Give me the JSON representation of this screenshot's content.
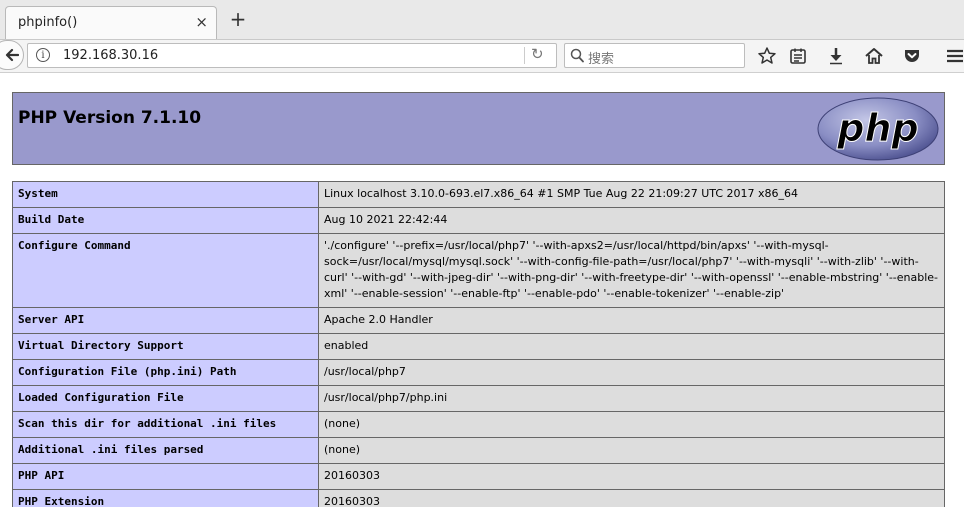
{
  "browser": {
    "tab_title": "phpinfo()",
    "tab_close": "×",
    "new_tab": "+",
    "url": "192.168.30.16",
    "search_placeholder": "搜索",
    "info_glyph": "i",
    "reload_glyph": "↻"
  },
  "phpinfo": {
    "title": "PHP Version 7.1.10",
    "logo_text": "php",
    "rows": [
      {
        "key": "System",
        "value": "Linux localhost 3.10.0-693.el7.x86_64 #1 SMP Tue Aug 22 21:09:27 UTC 2017 x86_64"
      },
      {
        "key": "Build Date",
        "value": "Aug 10 2021 22:42:44"
      },
      {
        "key": "Configure Command",
        "value": "'./configure' '--prefix=/usr/local/php7' '--with-apxs2=/usr/local/httpd/bin/apxs' '--with-mysql-sock=/usr/local/mysql/mysql.sock' '--with-config-file-path=/usr/local/php7' '--with-mysqli' '--with-zlib' '--with-curl' '--with-gd' '--with-jpeg-dir' '--with-png-dir' '--with-freetype-dir' '--with-openssl' '--enable-mbstring' '--enable-xml' '--enable-session' '--enable-ftp' '--enable-pdo' '--enable-tokenizer' '--enable-zip'"
      },
      {
        "key": "Server API",
        "value": "Apache 2.0 Handler"
      },
      {
        "key": "Virtual Directory Support",
        "value": "enabled"
      },
      {
        "key": "Configuration File (php.ini) Path",
        "value": "/usr/local/php7"
      },
      {
        "key": "Loaded Configuration File",
        "value": "/usr/local/php7/php.ini"
      },
      {
        "key": "Scan this dir for additional .ini files",
        "value": "(none)"
      },
      {
        "key": "Additional .ini files parsed",
        "value": "(none)"
      },
      {
        "key": "PHP API",
        "value": "20160303"
      },
      {
        "key": "PHP Extension",
        "value": "20160303"
      }
    ]
  },
  "colors": {
    "header_bg": "#9999cc",
    "key_cell_bg": "#ccccff",
    "value_cell_bg": "#dddddd"
  }
}
